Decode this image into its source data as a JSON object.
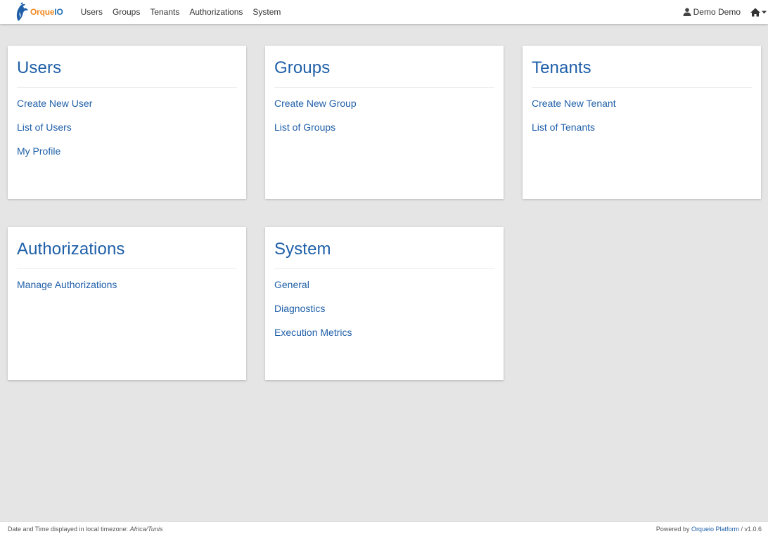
{
  "brand": {
    "part1": "Orque",
    "part2": "IO"
  },
  "nav": {
    "links": [
      "Users",
      "Groups",
      "Tenants",
      "Authorizations",
      "System"
    ],
    "user_label": "Demo Demo"
  },
  "cards": [
    {
      "title": "Users",
      "links": [
        "Create New User",
        "List of Users",
        "My Profile"
      ]
    },
    {
      "title": "Groups",
      "links": [
        "Create New Group",
        "List of Groups"
      ]
    },
    {
      "title": "Tenants",
      "links": [
        "Create New Tenant",
        "List of Tenants"
      ]
    },
    {
      "title": "Authorizations",
      "links": [
        "Manage Authorizations"
      ]
    },
    {
      "title": "System",
      "links": [
        "General",
        "Diagnostics",
        "Execution Metrics"
      ]
    }
  ],
  "footer": {
    "timezone_prefix": "Date and Time displayed in local timezone: ",
    "timezone": "Africa/Tunis",
    "powered_prefix": "Powered by ",
    "powered_link": "Orqueio Platform",
    "version": " / v1.0.6"
  },
  "colors": {
    "link": "#1f5fa8",
    "brand_orange": "#f08a24",
    "brand_blue": "#1f6fb5",
    "background": "#e5e5e5"
  },
  "icons": {
    "brand": "orca-logo-icon",
    "user": "user-icon",
    "home": "home-icon",
    "caret": "caret-down-icon"
  }
}
